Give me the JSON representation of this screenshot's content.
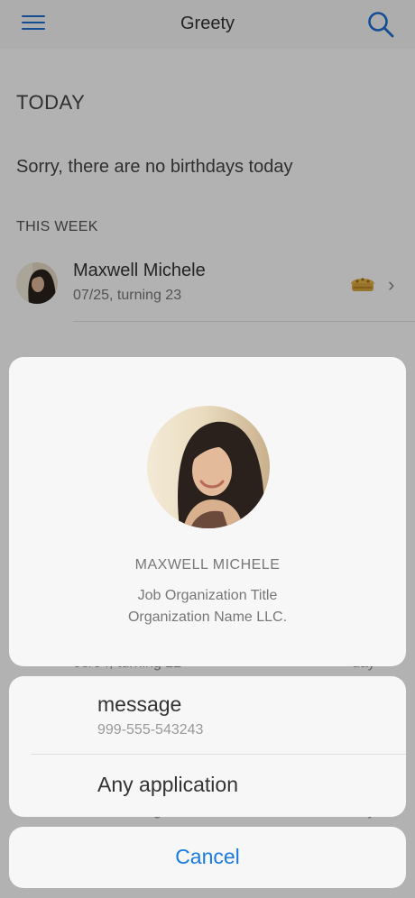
{
  "header": {
    "title": "Greety"
  },
  "today": {
    "section_label": "TODAY",
    "empty_text": "Sorry, there are no birthdays today"
  },
  "this_week": {
    "section_label": "THIS WEEK",
    "items": [
      {
        "name": "Maxwell Michele",
        "subtitle": "07/25, turning 23"
      }
    ]
  },
  "background_fragments": {
    "row_a_sub": "08/04, turning 22",
    "row_a_right": "day",
    "row_b_sub": "08/08, turning 24",
    "row_b_right": "day"
  },
  "contact": {
    "name": "MAXWELL MICHELE",
    "job_title": "Job Organization Title",
    "organization": "Organization Name LLC."
  },
  "options": {
    "message": {
      "label": "message",
      "phone": "999-555-543243"
    },
    "any_app": {
      "label": "Any application"
    }
  },
  "cancel": {
    "label": "Cancel"
  },
  "colors": {
    "accent": "#1a7ae0",
    "overlay": "rgba(0,0,0,0.30)"
  }
}
